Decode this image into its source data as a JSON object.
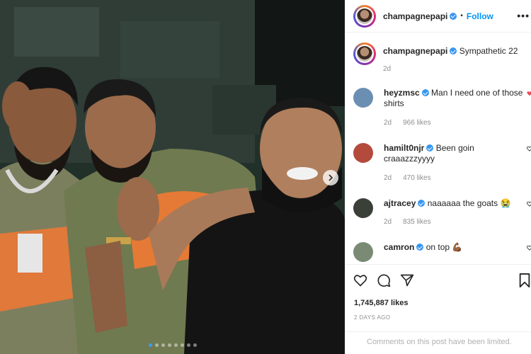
{
  "post": {
    "username": "champagnepapi",
    "follow_label": "Follow",
    "separator": "•",
    "more": "•••"
  },
  "caption": {
    "username": "champagnepapi",
    "text": "Sympathetic 22",
    "time": "2d"
  },
  "comments": [
    {
      "username": "heyzmsc",
      "text": "Man I need one of those shirts",
      "time": "2d",
      "likes": "966 likes",
      "avatar_color": "#6b8fb3"
    },
    {
      "username": "hamilt0njr",
      "text": "Been goin craaazzzyyyy",
      "time": "2d",
      "likes": "470 likes",
      "avatar_color": "#b44a3c"
    },
    {
      "username": "ajtracey",
      "text": "naaaaaa the goats 😭",
      "time": "2d",
      "likes": "835 likes",
      "avatar_color": "#3a3f38"
    },
    {
      "username": "camron",
      "text": "on top 💪🏾",
      "avatar_color": "#7a8a75"
    }
  ],
  "stats": {
    "likes": "1,745,887 likes",
    "posted": "2 DAYS AGO"
  },
  "footer": {
    "limited": "Comments on this post have been limited."
  },
  "photo": {
    "description_icon": "photo-of-three-men",
    "carousel": {
      "count": 8,
      "active_index": 0
    }
  },
  "colors": {
    "link_blue": "#0095f6",
    "verified_blue": "#3897f0",
    "muted": "#8e8e8e"
  }
}
